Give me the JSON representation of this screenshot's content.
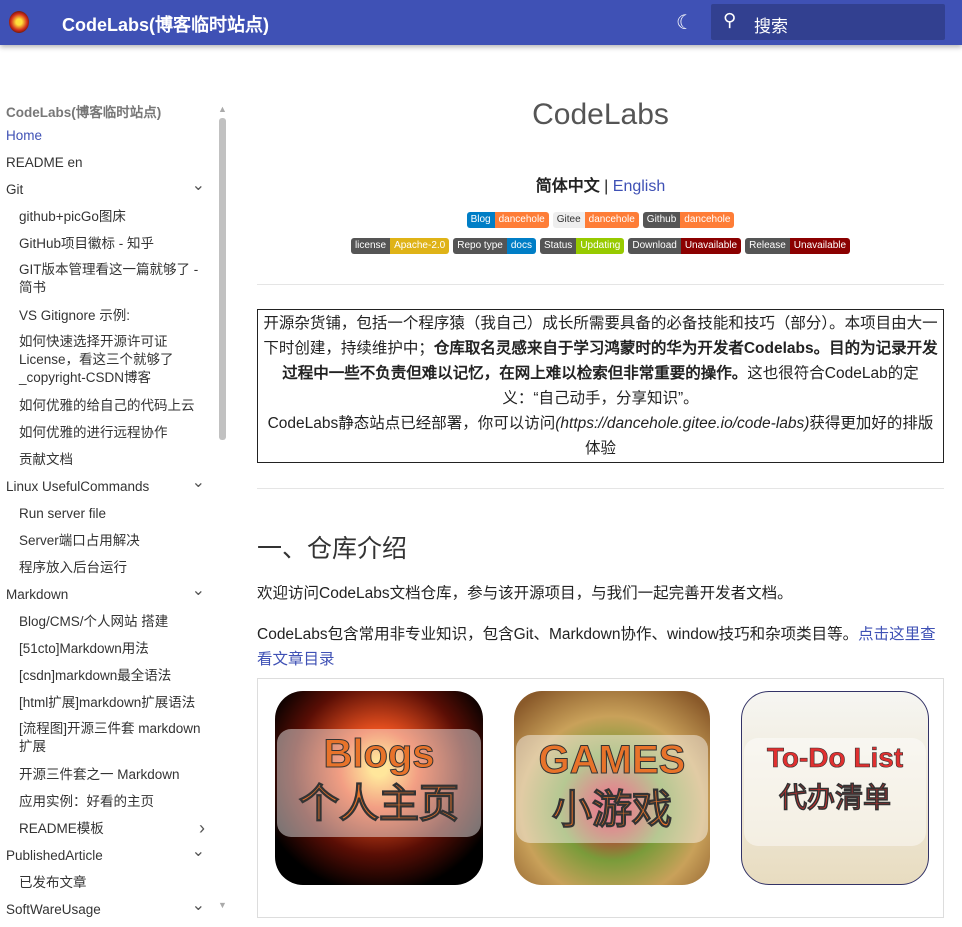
{
  "header": {
    "title": "CodeLabs(博客临时站点)",
    "search_placeholder": "搜索",
    "theme_icon": "moon-icon"
  },
  "sidebar": {
    "title": "CodeLabs(博客临时站点)",
    "items": [
      {
        "label": "Home",
        "level": 0,
        "active": true
      },
      {
        "label": "README en",
        "level": 0
      },
      {
        "label": "Git",
        "level": 0,
        "chevron": "down"
      },
      {
        "label": "github+picGo图床",
        "level": 1
      },
      {
        "label": "GitHub项目徽标 - 知乎",
        "level": 1
      },
      {
        "label": "GIT版本管理看这一篇就够了 - 简书",
        "level": 1
      },
      {
        "label": "VS Gitignore 示例:",
        "level": 1
      },
      {
        "label": "如何快速选择开源许可证License，看这三个就够了_copyright-CSDN博客",
        "level": 1
      },
      {
        "label": "如何优雅的给自己的代码上云",
        "level": 1
      },
      {
        "label": "如何优雅的进行远程协作",
        "level": 1
      },
      {
        "label": "贡献文档",
        "level": 1
      },
      {
        "label": "Linux UsefulCommands",
        "level": 0,
        "chevron": "down"
      },
      {
        "label": "Run server file",
        "level": 1
      },
      {
        "label": "Server端口占用解决",
        "level": 1
      },
      {
        "label": "程序放入后台运行",
        "level": 1
      },
      {
        "label": "Markdown",
        "level": 0,
        "chevron": "down"
      },
      {
        "label": "Blog/CMS/个人网站 搭建",
        "level": 1
      },
      {
        "label": "[51cto]Markdown用法",
        "level": 1
      },
      {
        "label": "[csdn]markdown最全语法",
        "level": 1
      },
      {
        "label": "[html扩展]markdown扩展语法",
        "level": 1
      },
      {
        "label": "[流程图]开源三件套 markdown扩展",
        "level": 1
      },
      {
        "label": "开源三件套之一 Markdown",
        "level": 1
      },
      {
        "label": "应用实例：好看的主页",
        "level": 1
      },
      {
        "label": "README模板",
        "level": 1,
        "chevron": "right"
      },
      {
        "label": "PublishedArticle",
        "level": 0,
        "chevron": "down"
      },
      {
        "label": "已发布文章",
        "level": 1
      },
      {
        "label": "SoftWareUsage",
        "level": 0,
        "chevron": "down"
      }
    ]
  },
  "main": {
    "title": "CodeLabs",
    "lang_current": "简体中文",
    "lang_sep": " | ",
    "lang_link": "English",
    "badges_row1": [
      {
        "left": "Blog",
        "right": "dancehole",
        "lc": "#007ec6",
        "rc": "#fe7d37",
        "ltext": "#fff"
      },
      {
        "left": "Gitee",
        "right": "dancehole",
        "lc": "#eeeeee",
        "rc": "#fe7d37",
        "ltext": "#333"
      },
      {
        "left": "Github",
        "right": "dancehole",
        "lc": "#555555",
        "rc": "#fe7d37",
        "ltext": "#fff"
      }
    ],
    "badges_row2": [
      {
        "left": "license",
        "right": "Apache-2.0",
        "lc": "#555555",
        "rc": "#dfb317",
        "ltext": "#fff"
      },
      {
        "left": "Repo type",
        "right": "docs",
        "lc": "#555555",
        "rc": "#007ec6",
        "ltext": "#fff"
      },
      {
        "left": "Status",
        "right": "Updating",
        "lc": "#555555",
        "rc": "#97ca00",
        "ltext": "#fff"
      },
      {
        "left": "Download",
        "right": "Unavailable",
        "lc": "#555555",
        "rc": "#8b0000",
        "ltext": "#fff"
      },
      {
        "left": "Release",
        "right": "Unavailable",
        "lc": "#555555",
        "rc": "#8b0000",
        "ltext": "#fff"
      }
    ],
    "intro_a": "开源杂货铺，包括一个程序猿（我自己）成长所需要具备的必备技能和技巧（部分）。本项目由大一下时创建，持续维护中；",
    "intro_bold": "仓库取名灵感来自于学习鸿蒙时的华为开发者Codelabs。目的为记录开发过程中一些不负责但难以记忆，在网上难以检索但非常重要的操作。",
    "intro_c": "这也很符合CodeLab的定义：“自己动手，分享知识”。",
    "intro_d": "CodeLabs静态站点已经部署，你可以访问",
    "intro_url": "(https://dancehole.gitee.io/code-labs)",
    "intro_e": "获得更加好的排版体验",
    "section_title": "一、仓库介绍",
    "p1": "欢迎访问CodeLabs文档仓库，参与该开源项目，与我们一起完善开发者文档。",
    "p2": "CodeLabs包含常用非专业知识，包含Git、Markdown协作、window技巧和杂项类目等。",
    "p2_link": "点击这里查看文章目录",
    "cards": [
      {
        "line1": "Blogs",
        "line2": "个人主页"
      },
      {
        "line1": "GAMES",
        "line2": "小游戏"
      },
      {
        "line1": "To-Do List",
        "line2": "代办清单"
      }
    ]
  }
}
